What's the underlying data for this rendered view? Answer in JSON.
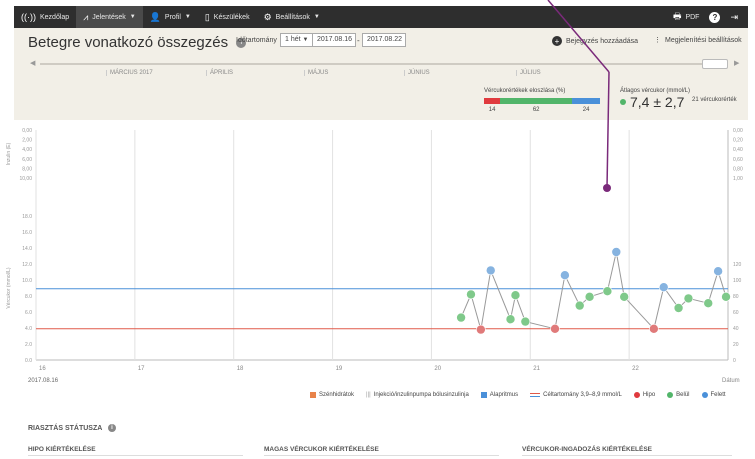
{
  "nav": {
    "home": "Kezdőlap",
    "reports": "Jelentések",
    "profile": "Profil",
    "devices": "Készülékek",
    "settings": "Beállítások",
    "pdf": "PDF"
  },
  "header": {
    "title": "Betegre vonatkozó összegzés",
    "range_label": "Időtartomány",
    "range_value": "1 hét",
    "date_from": "2017.08.16",
    "date_to": "2017.08.22",
    "add_entry": "Bejegyzés hozzáadása",
    "display_settings": "Megjelenítési beállítások"
  },
  "timeline": {
    "months": [
      "MÁRCIUS 2017",
      "ÁPRILIS",
      "MÁJUS",
      "JÚNIUS",
      "JÚLIUS"
    ]
  },
  "distribution": {
    "label": "Vércukorértékek eloszlása (%)",
    "values": [
      14,
      62,
      24
    ],
    "colors": [
      "#e03a3e",
      "#52b56a",
      "#4a90d9"
    ]
  },
  "average": {
    "label": "Átlagos vércukor (mmol/L)",
    "value": "7,4 ± 2,7",
    "count": "21 vércukorérték"
  },
  "chart_data": {
    "type": "scatter",
    "x_labels": [
      "16",
      "17",
      "18",
      "19",
      "20",
      "21",
      "22"
    ],
    "x_start": "2017.08.16",
    "x_axis_label": "Dátum",
    "insulin_axis": {
      "label": "Inzulin (E)",
      "ticks": [
        "0,00",
        "2,00",
        "4,00",
        "6,00",
        "8,00",
        "10,00"
      ]
    },
    "glucose_axis": {
      "label": "Vércukor (mmol/L)",
      "ticks": [
        "0.0",
        "2.0",
        "4.0",
        "6.0",
        "8.0",
        "10.0",
        "12.0",
        "14.0",
        "16.0",
        "18.0"
      ],
      "ylim": [
        0,
        18
      ]
    },
    "right_upper_ticks": [
      "0,00",
      "0,20",
      "0,40",
      "0,60",
      "0,80",
      "1,00"
    ],
    "right_lower_ticks": [
      "0",
      "20",
      "40",
      "60",
      "80",
      "100",
      "120"
    ],
    "target_upper": 8.9,
    "target_lower": 3.9,
    "points": [
      {
        "x": 20.3,
        "y": 5.3,
        "kind": "in"
      },
      {
        "x": 20.4,
        "y": 8.2,
        "kind": "in"
      },
      {
        "x": 20.5,
        "y": 3.8,
        "kind": "hypo"
      },
      {
        "x": 20.6,
        "y": 11.2,
        "kind": "high"
      },
      {
        "x": 20.8,
        "y": 5.1,
        "kind": "in"
      },
      {
        "x": 20.85,
        "y": 8.1,
        "kind": "in"
      },
      {
        "x": 20.95,
        "y": 4.8,
        "kind": "in"
      },
      {
        "x": 21.25,
        "y": 3.9,
        "kind": "hypo"
      },
      {
        "x": 21.35,
        "y": 10.6,
        "kind": "high"
      },
      {
        "x": 21.5,
        "y": 6.8,
        "kind": "in"
      },
      {
        "x": 21.6,
        "y": 7.9,
        "kind": "in"
      },
      {
        "x": 21.78,
        "y": 8.6,
        "kind": "in"
      },
      {
        "x": 21.87,
        "y": 13.5,
        "kind": "high"
      },
      {
        "x": 21.95,
        "y": 7.9,
        "kind": "in"
      },
      {
        "x": 22.25,
        "y": 3.9,
        "kind": "hypo"
      },
      {
        "x": 22.35,
        "y": 9.1,
        "kind": "high"
      },
      {
        "x": 22.5,
        "y": 6.5,
        "kind": "in"
      },
      {
        "x": 22.6,
        "y": 7.7,
        "kind": "in"
      },
      {
        "x": 22.8,
        "y": 7.1,
        "kind": "in"
      },
      {
        "x": 22.9,
        "y": 11.1,
        "kind": "high"
      },
      {
        "x": 22.98,
        "y": 7.9,
        "kind": "in"
      }
    ],
    "colors": {
      "hypo": "#e07a7a",
      "in": "#7fc98a",
      "high": "#86b3e0",
      "line": "#999999",
      "target_upper": "#4a90d9",
      "target_lower": "#e05a4a"
    }
  },
  "legend": [
    {
      "label": "Szénhidrátok",
      "color": "#e8834a",
      "shape": "square"
    },
    {
      "label": "Injekció/inzulinpumpa bólusinzulinja",
      "color": "#999999",
      "shape": "bars"
    },
    {
      "label": "Alapritmus",
      "color": "#4a90d9",
      "shape": "square"
    },
    {
      "label": "Céltartomány 3,9–8,9 mmol/L",
      "color": "#e05a4a",
      "shape": "range"
    },
    {
      "label": "Hipo",
      "color": "#e03a3e",
      "shape": "dot"
    },
    {
      "label": "Belül",
      "color": "#52b56a",
      "shape": "dot"
    },
    {
      "label": "Felett",
      "color": "#4a90d9",
      "shape": "dot"
    }
  ],
  "alerts": {
    "title": "RIASZTÁS STÁTUSZA",
    "hypo": "HIPO KIÉRTÉKELÉSE",
    "high": "MAGAS VÉRCUKOR KIÉRTÉKELÉSE",
    "variation": "VÉRCUKOR-INGADOZÁS KIÉRTÉKELÉSE"
  }
}
